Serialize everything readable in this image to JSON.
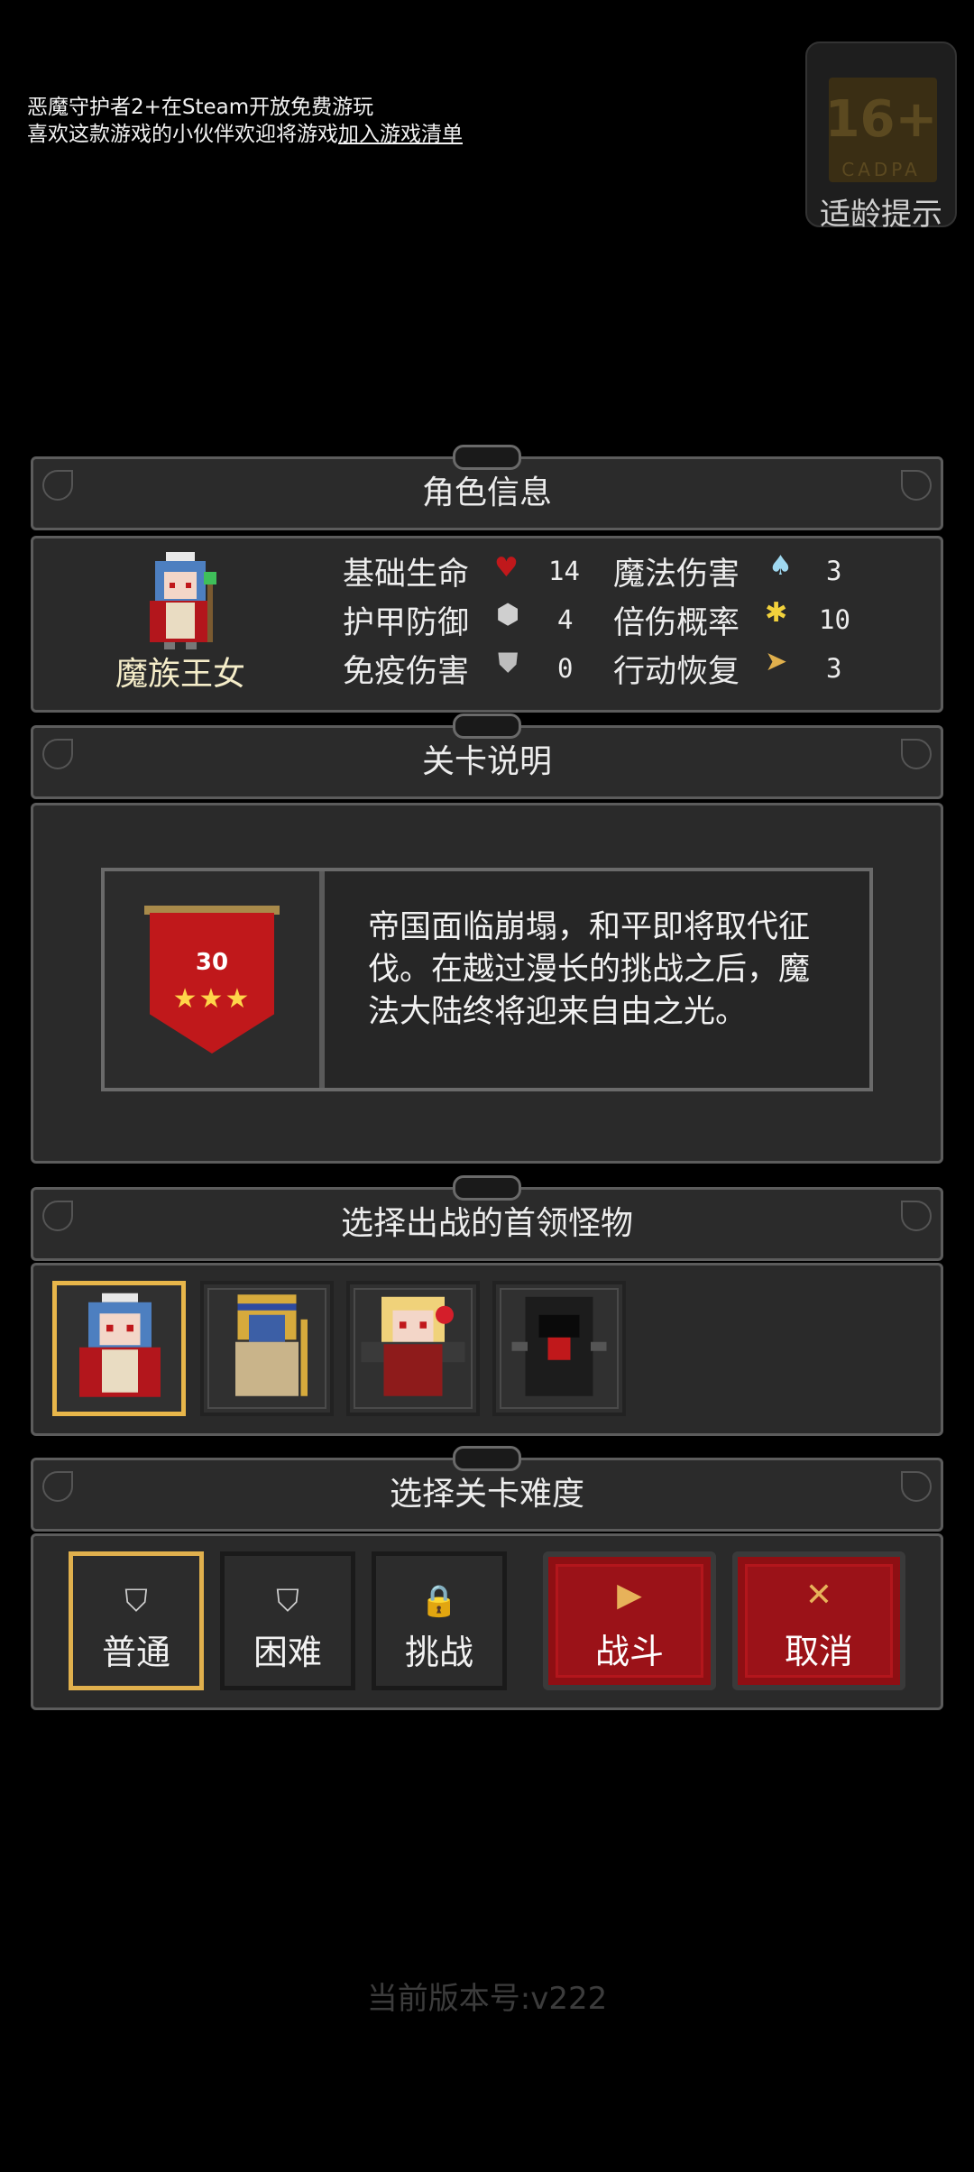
{
  "notice": {
    "line1": "恶魔守护者2+在Steam开放免费游玩",
    "line2_prefix": "喜欢这款游戏的小伙伴欢迎将游戏",
    "line2_link": "加入游戏清单"
  },
  "age_badge": {
    "rating": "16+",
    "org": "CADPA",
    "label": "适龄提示"
  },
  "character_panel": {
    "title": "角色信息",
    "name": "魔族王女",
    "stats": [
      {
        "label": "基础生命",
        "icon": "heart-icon",
        "value": "14"
      },
      {
        "label": "护甲防御",
        "icon": "armor-icon",
        "value": "4"
      },
      {
        "label": "免疫伤害",
        "icon": "shield-icon",
        "value": "0"
      },
      {
        "label": "魔法伤害",
        "icon": "magic-icon",
        "value": "3"
      },
      {
        "label": "倍伤概率",
        "icon": "crit-icon",
        "value": "10"
      },
      {
        "label": "行动恢复",
        "icon": "speed-icon",
        "value": "3"
      }
    ]
  },
  "level_panel": {
    "title": "关卡说明",
    "level_number": "30",
    "stars": "★★★",
    "description": "帝国面临崩塌，和平即将取代征伐。在越过漫长的挑战之后，魔法大陆终将迎来自由之光。"
  },
  "boss_panel": {
    "title": "选择出战的首领怪物",
    "bosses": [
      "demon-princess",
      "pharaoh-mummy",
      "vampire-girl",
      "shadow-reaper"
    ]
  },
  "difficulty_panel": {
    "title": "选择关卡难度",
    "options": [
      {
        "label": "普通",
        "icon": "shield-badge-icon",
        "selected": true
      },
      {
        "label": "困难",
        "icon": "shield-badge-icon",
        "selected": false
      },
      {
        "label": "挑战",
        "icon": "lock-icon",
        "selected": false
      }
    ],
    "fight_label": "战斗",
    "cancel_label": "取消"
  },
  "version": "当前版本号:v222",
  "colors": {
    "accent_gold": "#e0b04d",
    "button_red": "#9b1218",
    "panel_bg": "#2a2a2a"
  }
}
